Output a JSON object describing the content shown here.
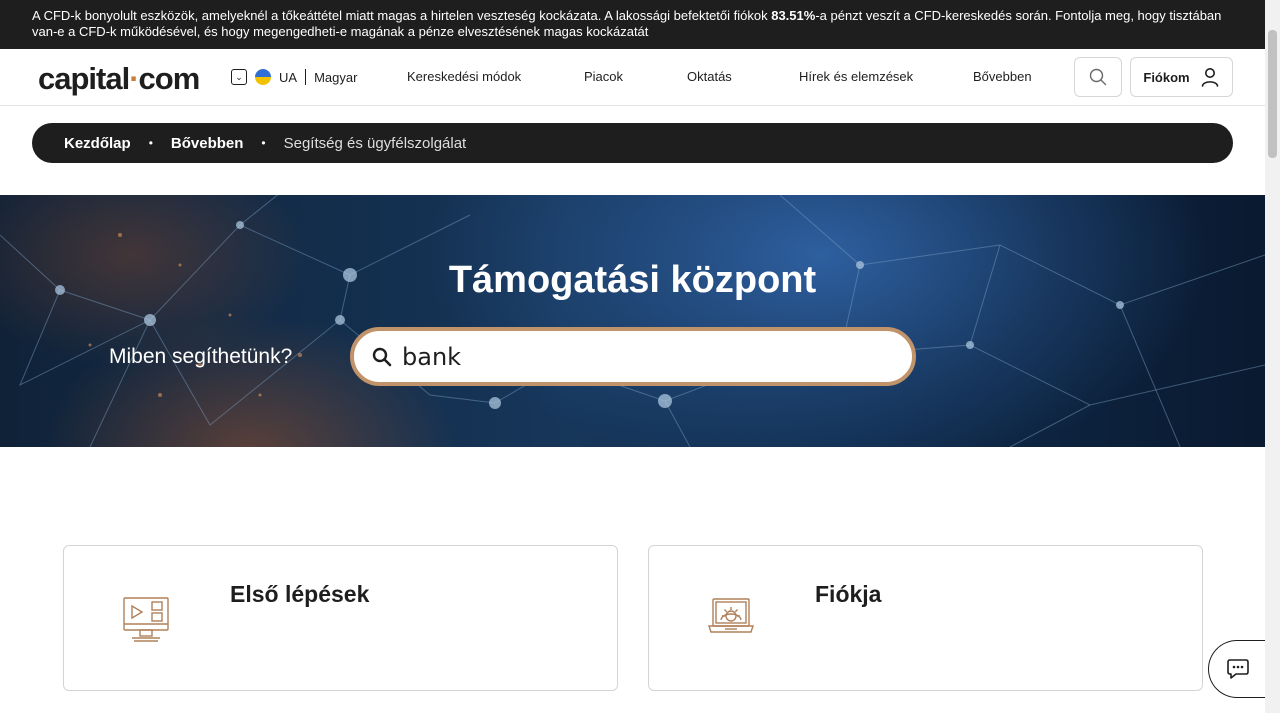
{
  "risk_warning": {
    "text_before": "A CFD-k bonyolult eszközök, amelyeknél a tőkeáttétel miatt magas a hirtelen veszteség kockázata. A lakossági befektetői fiókok ",
    "percent": "83.51%",
    "text_after": "-a pénzt veszít a CFD-kereskedés során. Fontolja meg, hogy tisztában van-e a CFD-k működésével, és hogy megengedheti-e magának a pénze elvesztésének magas kockázatát"
  },
  "header": {
    "logo_left": "capital",
    "logo_dot": "·",
    "logo_right": "com",
    "region_code": "UA",
    "language": "Magyar",
    "menu": [
      {
        "label": "Kereskedési módok"
      },
      {
        "label": "Piacok"
      },
      {
        "label": "Oktatás"
      },
      {
        "label": "Hírek és elemzések"
      },
      {
        "label": "Bővebben"
      }
    ],
    "account_label": "Fiókom"
  },
  "breadcrumb": {
    "items": [
      "Kezdőlap",
      "Bővebben",
      "Segítség és ügyfélszolgálat"
    ]
  },
  "hero": {
    "title": "Támogatási központ",
    "prompt": "Miben segíthetünk?",
    "search_value": "bank"
  },
  "cards": [
    {
      "title": "Első lépések",
      "icon": "monitor-play-icon"
    },
    {
      "title": "Fiókja",
      "icon": "laptop-gear-icon"
    }
  ],
  "colors": {
    "accent": "#c97d3f",
    "dark": "#1e1e1e",
    "search_border": "#c1936a"
  }
}
